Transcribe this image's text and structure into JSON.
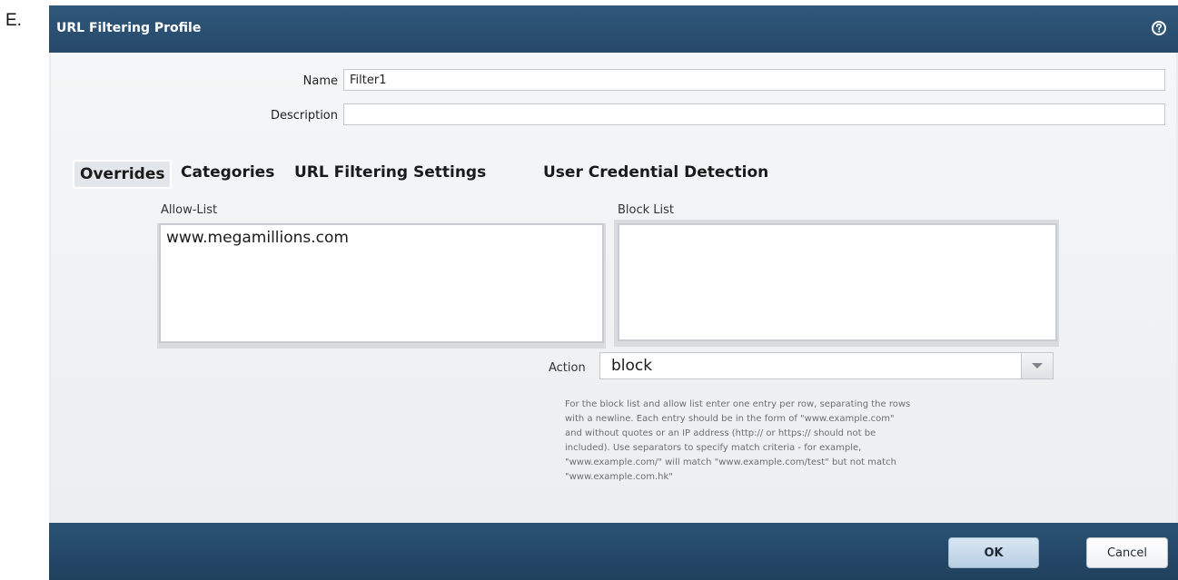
{
  "question": {
    "label": "E."
  },
  "dialog": {
    "title": "URL Filtering Profile",
    "help_icon": "help-circle-icon"
  },
  "form": {
    "name_label": "Name",
    "name_value": "Filter1",
    "description_label": "Description",
    "description_value": ""
  },
  "tabs": [
    {
      "label": "Overrides",
      "active": true
    },
    {
      "label": "Categories",
      "active": false
    },
    {
      "label": "URL Filtering Settings",
      "active": false
    },
    {
      "label": "User Credential Detection",
      "active": false
    }
  ],
  "allow_list": {
    "label": "Allow-List",
    "entries": [
      "www.megamillions.com"
    ]
  },
  "block_list": {
    "label": "Block List",
    "entries": []
  },
  "action": {
    "label": "Action",
    "value": "block",
    "dropdown_icon": "chevron-down-icon"
  },
  "help_text": {
    "lines": [
      "For the block list and allow list enter one entry per row, separating the rows",
      "with a newline. Each entry should be in the form of \"www.example.com\"",
      "and without quotes or an IP address (http:// or https:// should not be",
      "included). Use separators to specify match criteria - for example,",
      "\"www.example.com/\" will match \"www.example.com/test\" but not match",
      "\"www.example.com.hk\""
    ]
  },
  "footer": {
    "ok_label": "OK",
    "cancel_label": "Cancel"
  },
  "colors": {
    "titlebar": "#2f587a",
    "footer": "#24476a",
    "ok_button": "#c6d9ea"
  }
}
